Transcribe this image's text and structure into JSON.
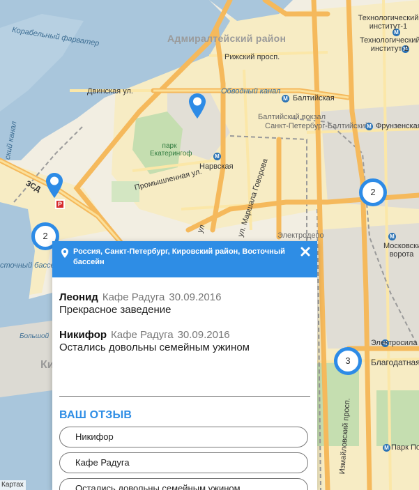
{
  "map": {
    "district_label": "Адмиралтейский район",
    "labels": {
      "korabelny": "Корабельный фарватер",
      "dvinskaya": "Двинская ул.",
      "rizhsky": "Рижский просп.",
      "obvodny": "Обводный канал",
      "baltiyskaya": "Балтийская",
      "baltiysky_vokzal": "Балтийский вокзал",
      "spb_baltiysky": "Санкт-Петербург-Балтийский",
      "frunzenskaya": "Фрунзенская",
      "tech_inst_1": "Технологический институт-1",
      "tech_inst_2": "Технологический институт-2",
      "park_ekateringof": "парк Екатерингоф",
      "narvskaya": "Нарвская",
      "promyshlennaya": "Промышленная ул.",
      "marshala_govorova": "ул. Маршала Говорова",
      "elektrodepo": "Электродепо",
      "moskovskie_vorota": "Московские ворота",
      "elektrosila": "Электросила",
      "blagodatnaya": "Благодатная",
      "izmailovsky": "Измайловский просп.",
      "park_pobedy": "Парк Победы",
      "zsd": "ЗСД",
      "kanal": "ский канал",
      "morskoy_bassein": "сточный бассейн",
      "bolshoy": "Большой",
      "ki": "Ки",
      "ul_stub": "ул"
    },
    "metro_letter": "М",
    "clusters": [
      "2",
      "2",
      "3"
    ],
    "route_badge": "Р",
    "attribution": "Картах"
  },
  "colors": {
    "accent": "#2e8de5",
    "water": "#a9c6dc",
    "park": "#c5deb0",
    "road_major": "#f5b95c",
    "road_minor": "#fbe7a8",
    "land": "#f2eee2",
    "urban": "#f7ecc4"
  },
  "popup": {
    "location": "Россия, Санкт-Петербург, Кировский район, Восточный бассейн",
    "location_icon": "map-marker-icon",
    "close_icon": "close-icon",
    "reviews": [
      {
        "name": "Леонид",
        "place": "Кафе Радуга",
        "date": "30.09.2016",
        "text": "Прекрасное заведение"
      },
      {
        "name": "Никифор",
        "place": "Кафе Радуга",
        "date": "30.09.2016",
        "text": "Остались довольны семейным ужином"
      }
    ],
    "form": {
      "title": "ВАШ ОТЗЫВ",
      "name_value": "Никифор",
      "place_value": "Кафе Радуга",
      "text_value": "Остались довольны семейным ужином"
    }
  }
}
